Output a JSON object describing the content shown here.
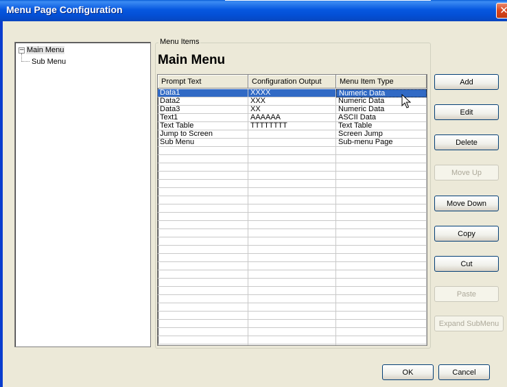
{
  "window": {
    "title": "Menu Page Configuration",
    "close_glyph": "✕"
  },
  "tree": {
    "toggle": "−",
    "items": [
      {
        "label": "Main Menu"
      },
      {
        "label": "Sub Menu"
      }
    ]
  },
  "group_label": "Menu Items",
  "heading": "Main Menu",
  "grid": {
    "columns": [
      "Prompt Text",
      "Configuration Output",
      "Menu Item Type"
    ],
    "rows": [
      [
        "Data1",
        "XXXX",
        "Numeric Data"
      ],
      [
        "Data2",
        "XXX",
        "Numeric Data"
      ],
      [
        "Data3",
        "XX",
        "Numeric Data"
      ],
      [
        "Text1",
        "AAAAAA",
        "ASCII Data"
      ],
      [
        "Text Table",
        "TTTTTTTT",
        "Text Table"
      ],
      [
        "Jump to Screen",
        "",
        "Screen Jump"
      ],
      [
        "Sub Menu",
        "",
        "Sub-menu Page"
      ],
      [
        "",
        "",
        ""
      ],
      [
        "",
        "",
        ""
      ],
      [
        "",
        "",
        ""
      ],
      [
        "",
        "",
        ""
      ],
      [
        "",
        "",
        ""
      ],
      [
        "",
        "",
        ""
      ],
      [
        "",
        "",
        ""
      ],
      [
        "",
        "",
        ""
      ],
      [
        "",
        "",
        ""
      ],
      [
        "",
        "",
        ""
      ],
      [
        "",
        "",
        ""
      ],
      [
        "",
        "",
        ""
      ],
      [
        "",
        "",
        ""
      ],
      [
        "",
        "",
        ""
      ],
      [
        "",
        "",
        ""
      ],
      [
        "",
        "",
        ""
      ],
      [
        "",
        "",
        ""
      ],
      [
        "",
        "",
        ""
      ],
      [
        "",
        "",
        ""
      ],
      [
        "",
        "",
        ""
      ],
      [
        "",
        "",
        ""
      ],
      [
        "",
        "",
        ""
      ],
      [
        "",
        "",
        ""
      ],
      [
        "",
        "",
        ""
      ],
      [
        "",
        "",
        ""
      ]
    ],
    "selected_row": 0
  },
  "buttons": {
    "add": "Add",
    "edit": "Edit",
    "delete": "Delete",
    "move_up": "Move Up",
    "move_down": "Move Down",
    "copy": "Copy",
    "cut": "Cut",
    "paste": "Paste",
    "expand_submenu": "Expand SubMenu",
    "ok": "OK",
    "cancel": "Cancel"
  }
}
